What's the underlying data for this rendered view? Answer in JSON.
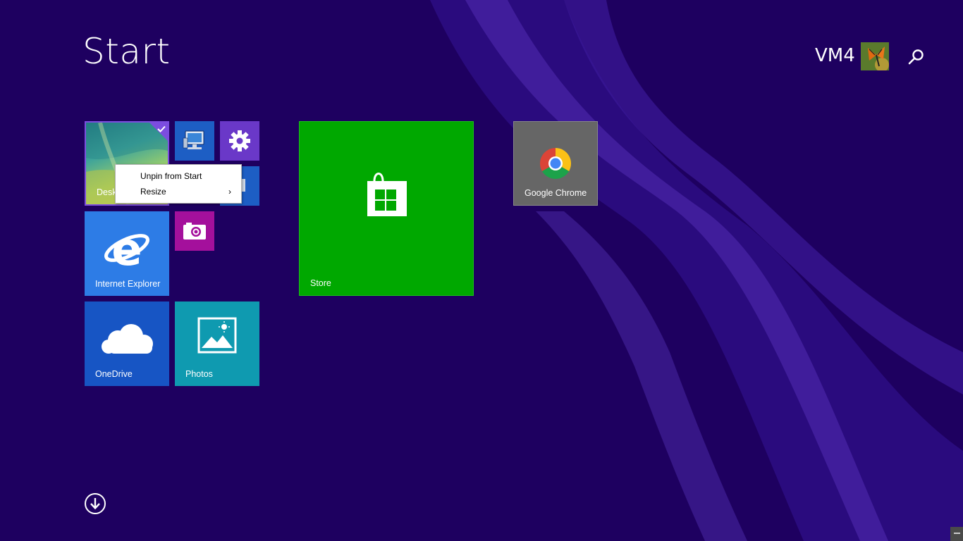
{
  "screen": {
    "title": "Start",
    "user": {
      "name": "VM4"
    }
  },
  "tiles": {
    "desktop": {
      "label": "Desktop",
      "selected": true
    },
    "internet_explorer": {
      "label": "Internet Explorer"
    },
    "onedrive": {
      "label": "OneDrive"
    },
    "photos": {
      "label": "Photos"
    },
    "store": {
      "label": "Store"
    },
    "google_chrome": {
      "label": "Google Chrome"
    }
  },
  "context_menu": {
    "items": [
      {
        "label": "Unpin from Start"
      },
      {
        "label": "Resize",
        "has_submenu": true
      }
    ],
    "submenu_arrow": "›"
  },
  "icons": {
    "search": "search-icon",
    "computer": "computer-icon",
    "settings": "gear-icon",
    "camera": "camera-icon",
    "ie": "internet-explorer-icon",
    "onedrive": "cloud-icon",
    "photos": "photo-icon",
    "store": "shopping-bag-icon",
    "chrome": "chrome-icon",
    "apps": "arrow-down-circle-icon",
    "check": "checkmark-icon"
  },
  "colors": {
    "background": "#1e0060",
    "selection": "#7c4de0",
    "store": "#00a800",
    "internet_explorer": "#2d7ce6",
    "onedrive": "#1755c4",
    "photos": "#0f9ab0",
    "camera": "#a4109c",
    "settings": "#6a38c8",
    "chrome_tile": "#666666"
  }
}
